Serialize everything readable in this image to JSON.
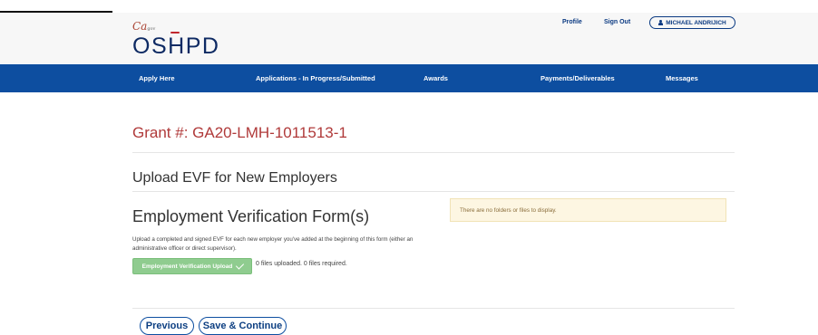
{
  "header": {
    "ca_logo_text": "Ca",
    "ca_logo_sub": "gov",
    "brand_prefix": "OS",
    "brand_h": "H",
    "brand_suffix": "PD",
    "profile_label": "Profile",
    "signout_label": "Sign Out",
    "user_name": "MICHAEL ANDRIJICH"
  },
  "nav": {
    "items": [
      {
        "label": "Apply Here"
      },
      {
        "label": "Applications - In Progress/Submitted"
      },
      {
        "label": "Awards"
      },
      {
        "label": "Payments/Deliverables"
      },
      {
        "label": "Messages"
      }
    ]
  },
  "main": {
    "grant_title": "Grant #: GA20-LMH-1011513-1",
    "section_title": "Upload EVF for New Employers",
    "form_title": "Employment Verification Form(s)",
    "description": "Upload a completed and signed EVF for each new employer you've added at the beginning of this form (either an administrative officer or direct supervisor).",
    "upload_button_label": "Employment Verification Upload",
    "upload_status": "0 files uploaded. 0 files required.",
    "alert_text": "There are no folders or files to display."
  },
  "footer": {
    "previous_label": "Previous",
    "save_continue_label": "Save & Continue"
  },
  "colors": {
    "nav_bg": "#0d4ea0",
    "grant_red": "#b03a3a",
    "upload_green": "#8fcc8f",
    "alert_bg": "#fdf6e2"
  }
}
